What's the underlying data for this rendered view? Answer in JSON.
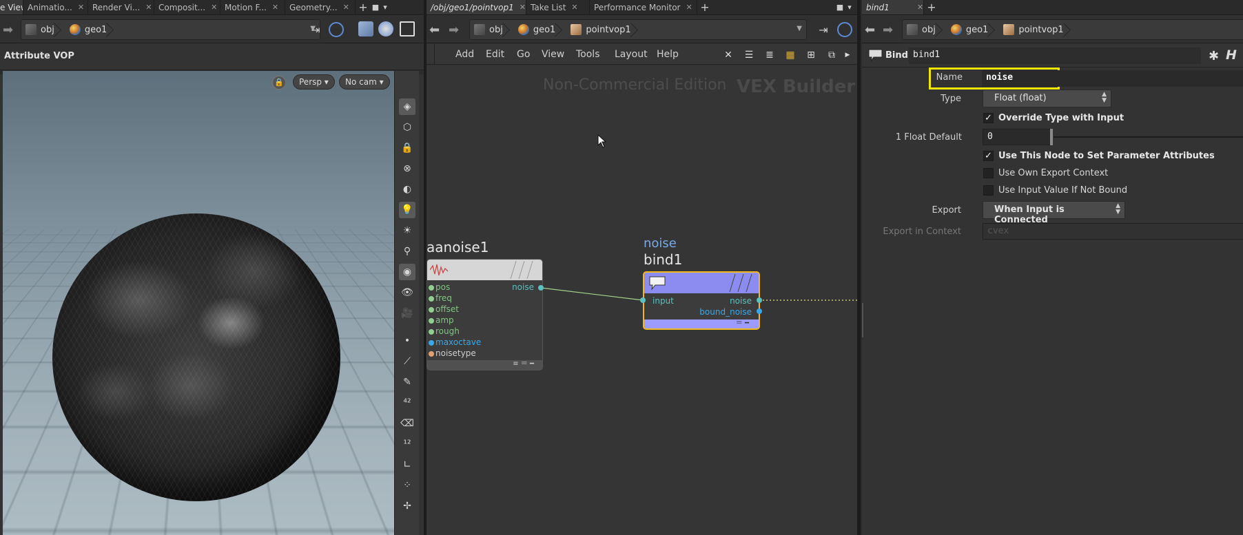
{
  "left_pane": {
    "tabs": [
      {
        "label": "e View",
        "active": true
      },
      {
        "label": "Animatio...",
        "active": false
      },
      {
        "label": "Render Vi...",
        "active": false
      },
      {
        "label": "Composit...",
        "active": false
      },
      {
        "label": "Motion F...",
        "active": false
      },
      {
        "label": "Geometry...",
        "active": false
      }
    ],
    "path": [
      "obj",
      "geo1"
    ],
    "title": "Attribute VOP",
    "viewport": {
      "persp_label": "Persp ▾",
      "cam_label": "No cam ▾"
    }
  },
  "mid_pane": {
    "tabs": [
      {
        "label": "/obj/geo1/pointvop1",
        "active": true
      },
      {
        "label": "Take List",
        "active": false
      },
      {
        "label": "Performance Monitor",
        "active": false
      }
    ],
    "path": [
      "obj",
      "geo1",
      "pointvop1"
    ],
    "menu": [
      "Add",
      "Edit",
      "Go",
      "View",
      "Tools",
      "Layout",
      "Help"
    ],
    "watermark": "Non-Commercial Edition",
    "context_label": "VEX Builder",
    "nodes": {
      "aanoise": {
        "name": "aanoise1",
        "inputs": [
          "pos",
          "freq",
          "offset",
          "amp",
          "rough",
          "maxoctave",
          "noisetype"
        ],
        "output": "noise"
      },
      "bind": {
        "upper_label": "noise",
        "name": "bind1",
        "input": "input",
        "outputs": [
          "noise",
          "bound_noise"
        ]
      }
    }
  },
  "right_pane": {
    "tabs": [
      {
        "label": "bind1",
        "active": true
      }
    ],
    "path": [
      "obj",
      "geo1",
      "pointvop1"
    ],
    "node_type": "Bind",
    "node_name": "bind1",
    "params": {
      "name_label": "Name",
      "name_value": "noise",
      "type_label": "Type",
      "type_value": "Float (float)",
      "override_label": "Override Type with Input",
      "override_checked": true,
      "float_default_label": "1 Float Default",
      "float_default_value": "0",
      "use_node_label": "Use This Node to Set Parameter Attributes",
      "use_node_checked": true,
      "own_export_label": "Use Own Export Context",
      "own_export_checked": false,
      "input_value_label": "Use Input Value If Not Bound",
      "input_value_checked": false,
      "export_label": "Export",
      "export_value": "When Input is Connected",
      "export_context_label": "Export in Context",
      "export_context_value": "cvex"
    }
  },
  "colors": {
    "highlight": "#f2e600",
    "bind_node": "#9c9cff",
    "selected_border": "#f2b91f",
    "wire": "#a8d48c",
    "port_blue": "#3aa8e8"
  }
}
